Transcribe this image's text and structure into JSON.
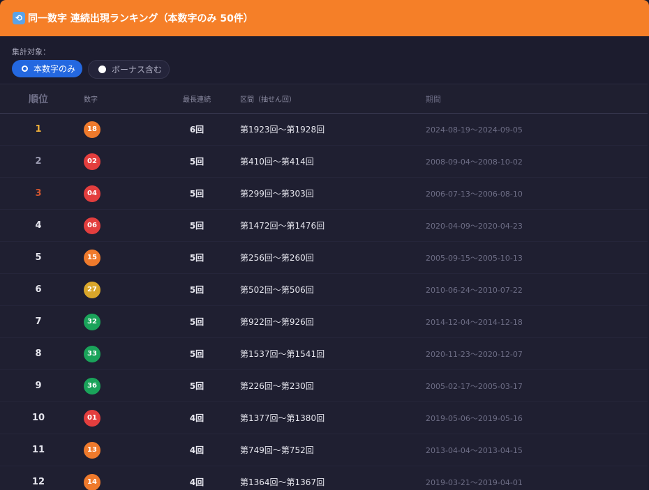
{
  "header": {
    "icon": "repeat-icon",
    "title": "同一数字 連続出現ランキング（本数字のみ 50件）"
  },
  "filter": {
    "label": "集計対象：",
    "options": [
      {
        "label": "本数字のみ",
        "selected": true
      },
      {
        "label": "ボーナス含む",
        "selected": false
      }
    ]
  },
  "columns": {
    "rank": "順位",
    "number": "数字",
    "streak": "最長連続",
    "range": "区間（抽せん回）",
    "period": "期間"
  },
  "colors": {
    "header": "#f57f28",
    "accent": "#2468e0",
    "rank1": "#f0b03a",
    "rank3": "#d2552f",
    "ball_red": "#e33e3e",
    "ball_orange": "#ef7a2c",
    "ball_yellow": "#d9a62a",
    "ball_green": "#1aa35a"
  },
  "rows": [
    {
      "rank": "1",
      "number": "18",
      "color": "#ef7a2c",
      "streak": "6回",
      "range": "第1923回〜第1928回",
      "period": "2024-08-19〜2024-09-05",
      "rank_color": "#f0b03a"
    },
    {
      "rank": "2",
      "number": "02",
      "color": "#e33e3e",
      "streak": "5回",
      "range": "第410回〜第414回",
      "period": "2008-09-04〜2008-10-02",
      "rank_color": "#9a9ab0"
    },
    {
      "rank": "3",
      "number": "04",
      "color": "#e33e3e",
      "streak": "5回",
      "range": "第299回〜第303回",
      "period": "2006-07-13〜2006-08-10",
      "rank_color": "#d2552f"
    },
    {
      "rank": "4",
      "number": "06",
      "color": "#e33e3e",
      "streak": "5回",
      "range": "第1472回〜第1476回",
      "period": "2020-04-09〜2020-04-23",
      "rank_color": "#e6e6ee"
    },
    {
      "rank": "5",
      "number": "15",
      "color": "#ef7a2c",
      "streak": "5回",
      "range": "第256回〜第260回",
      "period": "2005-09-15〜2005-10-13",
      "rank_color": "#e6e6ee"
    },
    {
      "rank": "6",
      "number": "27",
      "color": "#d9a62a",
      "streak": "5回",
      "range": "第502回〜第506回",
      "period": "2010-06-24〜2010-07-22",
      "rank_color": "#e6e6ee"
    },
    {
      "rank": "7",
      "number": "32",
      "color": "#1aa35a",
      "streak": "5回",
      "range": "第922回〜第926回",
      "period": "2014-12-04〜2014-12-18",
      "rank_color": "#e6e6ee"
    },
    {
      "rank": "8",
      "number": "33",
      "color": "#1aa35a",
      "streak": "5回",
      "range": "第1537回〜第1541回",
      "period": "2020-11-23〜2020-12-07",
      "rank_color": "#e6e6ee"
    },
    {
      "rank": "9",
      "number": "36",
      "color": "#1aa35a",
      "streak": "5回",
      "range": "第226回〜第230回",
      "period": "2005-02-17〜2005-03-17",
      "rank_color": "#e6e6ee"
    },
    {
      "rank": "10",
      "number": "01",
      "color": "#e33e3e",
      "streak": "4回",
      "range": "第1377回〜第1380回",
      "period": "2019-05-06〜2019-05-16",
      "rank_color": "#e6e6ee"
    },
    {
      "rank": "11",
      "number": "13",
      "color": "#ef7a2c",
      "streak": "4回",
      "range": "第749回〜第752回",
      "period": "2013-04-04〜2013-04-15",
      "rank_color": "#e6e6ee"
    },
    {
      "rank": "12",
      "number": "14",
      "color": "#ef7a2c",
      "streak": "4回",
      "range": "第1364回〜第1367回",
      "period": "2019-03-21〜2019-04-01",
      "rank_color": "#e6e6ee"
    }
  ]
}
